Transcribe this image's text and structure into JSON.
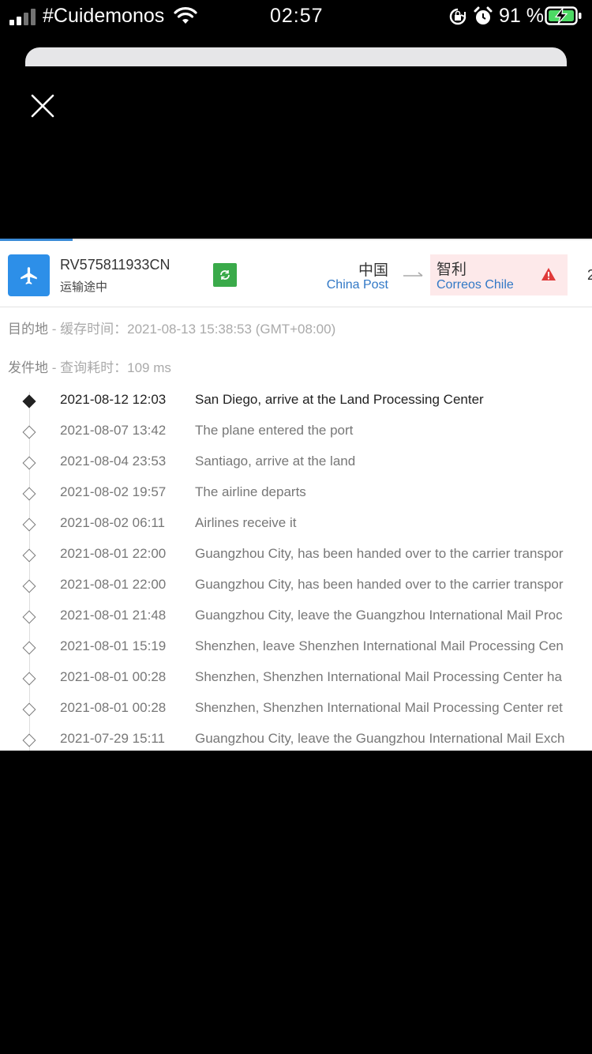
{
  "status_bar": {
    "carrier": "#Cuidemonos",
    "time": "02:57",
    "battery_percent": "91 %",
    "icons": [
      "signal-icon",
      "wifi-icon",
      "rotation-lock-icon",
      "alarm-icon",
      "battery-charging-icon"
    ]
  },
  "header": {
    "tracking_number": "RV575811933CN",
    "status": "运输途中",
    "origin_country": "中国",
    "origin_carrier": "China Post",
    "dest_country": "智利",
    "dest_carrier": "Correos Chile",
    "cut_off_text": "2"
  },
  "meta": {
    "destination_label": "目的地",
    "cache_label": "缓存时间：",
    "cache_time": "2021-08-13 15:38:53 (GMT+08:00)",
    "origin_label": "发件地",
    "query_label": "查询耗时：",
    "query_time": "109 ms",
    "separator": " - "
  },
  "events": [
    {
      "datetime": "2021-08-12 12:03",
      "description": "San Diego, arrive at the Land Processing Center"
    },
    {
      "datetime": "2021-08-07 13:42",
      "description": "The plane entered the port"
    },
    {
      "datetime": "2021-08-04 23:53",
      "description": "Santiago, arrive at the land"
    },
    {
      "datetime": "2021-08-02 19:57",
      "description": "The airline departs"
    },
    {
      "datetime": "2021-08-02 06:11",
      "description": "Airlines receive it"
    },
    {
      "datetime": "2021-08-01 22:00",
      "description": "Guangzhou City, has been handed over to the carrier transpor"
    },
    {
      "datetime": "2021-08-01 22:00",
      "description": "Guangzhou City, has been handed over to the carrier transpor"
    },
    {
      "datetime": "2021-08-01 21:48",
      "description": "Guangzhou City, leave the Guangzhou International Mail Proc"
    },
    {
      "datetime": "2021-08-01 15:19",
      "description": "Shenzhen, leave Shenzhen International Mail Processing Cen"
    },
    {
      "datetime": "2021-08-01 00:28",
      "description": "Shenzhen, Shenzhen International Mail Processing Center ha"
    },
    {
      "datetime": "2021-08-01 00:28",
      "description": "Shenzhen, Shenzhen International Mail Processing Center ret"
    },
    {
      "datetime": "2021-07-29 15:11",
      "description": "Guangzhou City, leave the Guangzhou International Mail Exch"
    }
  ]
}
